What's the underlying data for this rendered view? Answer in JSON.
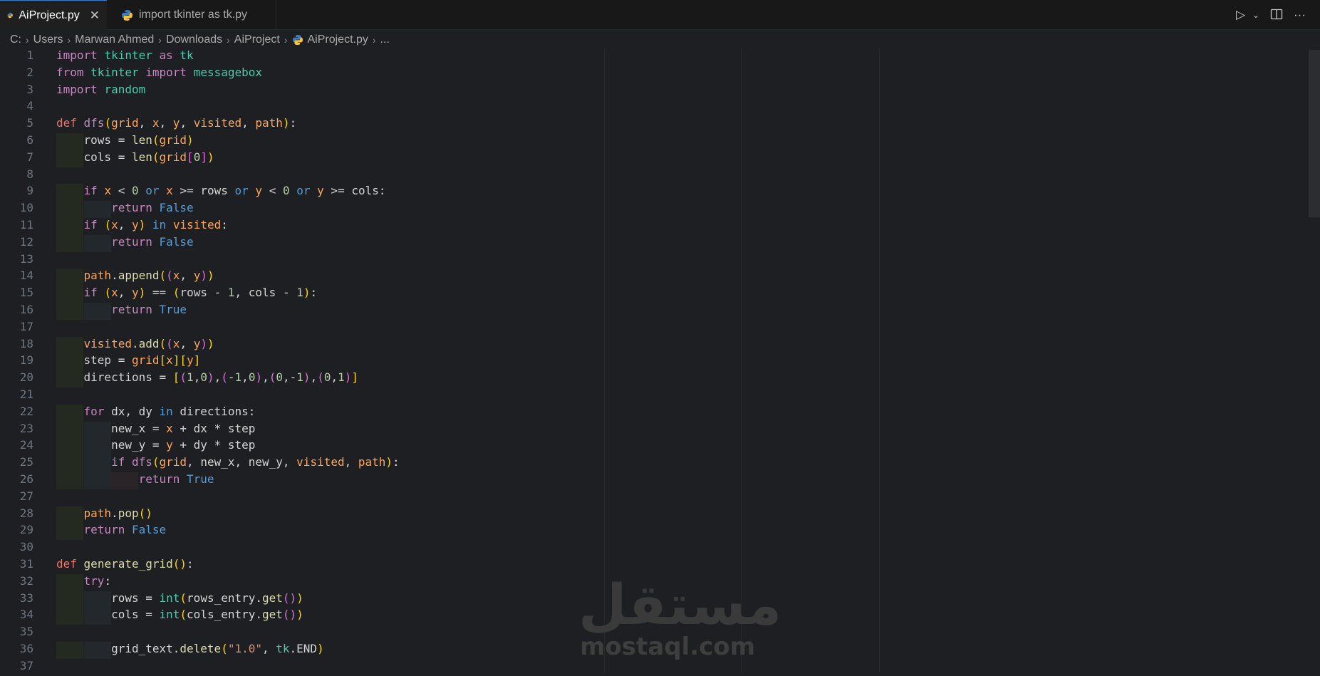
{
  "tabs": [
    {
      "label": "AiProject.py",
      "active": true
    },
    {
      "label": "import tkinter as tk.py",
      "active": false
    }
  ],
  "breadcrumb": [
    "C:",
    "Users",
    "Marwan Ahmed",
    "Downloads",
    "AiProject",
    "AiProject.py",
    "..."
  ],
  "watermark": {
    "arabic": "مستقل",
    "latin": "mostaql.com"
  },
  "lines": [
    {
      "n": "1",
      "html": "<span class=\"kw\">import</span> <span class=\"mod\">tkinter</span> <span class=\"kw\">as</span> <span class=\"mod\">tk</span>"
    },
    {
      "n": "2",
      "html": "<span class=\"kw\">from</span> <span class=\"mod\">tkinter</span> <span class=\"kw\">import</span> <span class=\"mod\">messagebox</span>"
    },
    {
      "n": "3",
      "html": "<span class=\"kw\">import</span> <span class=\"mod\">random</span>"
    },
    {
      "n": "4",
      "html": ""
    },
    {
      "n": "5",
      "html": "<span class=\"def\">def</span> <span class=\"fnc\">dfs</span><span class=\"p1\">(</span><span class=\"prm\">grid</span>, <span class=\"prm\">x</span>, <span class=\"prm\">y</span>, <span class=\"prm\">visited</span>, <span class=\"prm\">path</span><span class=\"p1\">)</span>:"
    },
    {
      "n": "6",
      "html": "    rows = <span class=\"bi\">len</span><span class=\"p1\">(</span><span class=\"prm\">grid</span><span class=\"p1\">)</span>"
    },
    {
      "n": "7",
      "html": "    cols = <span class=\"bi\">len</span><span class=\"p1\">(</span><span class=\"prm\">grid</span><span class=\"p2\">[</span><span class=\"num\">0</span><span class=\"p2\">]</span><span class=\"p1\">)</span>"
    },
    {
      "n": "8",
      "html": ""
    },
    {
      "n": "9",
      "html": "    <span class=\"kw\">if</span> <span class=\"prm\">x</span> &lt; <span class=\"num\">0</span> <span class=\"kw2\">or</span> <span class=\"prm\">x</span> &gt;= rows <span class=\"kw2\">or</span> <span class=\"prm\">y</span> &lt; <span class=\"num\">0</span> <span class=\"kw2\">or</span> <span class=\"prm\">y</span> &gt;= cols:"
    },
    {
      "n": "10",
      "html": "        <span class=\"kw\">return</span> <span class=\"kw2\">False</span>"
    },
    {
      "n": "11",
      "html": "    <span class=\"kw\">if</span> <span class=\"p1\">(</span><span class=\"prm\">x</span>, <span class=\"prm\">y</span><span class=\"p1\">)</span> <span class=\"kw2\">in</span> <span class=\"prm\">visited</span>:"
    },
    {
      "n": "12",
      "html": "        <span class=\"kw\">return</span> <span class=\"kw2\">False</span>"
    },
    {
      "n": "13",
      "html": ""
    },
    {
      "n": "14",
      "html": "    <span class=\"prm\">path</span>.<span class=\"fn\">append</span><span class=\"p1\">(</span><span class=\"p2\">(</span><span class=\"prm\">x</span>, <span class=\"prm\">y</span><span class=\"p2\">)</span><span class=\"p1\">)</span>"
    },
    {
      "n": "15",
      "html": "    <span class=\"kw\">if</span> <span class=\"p1\">(</span><span class=\"prm\">x</span>, <span class=\"prm\">y</span><span class=\"p1\">)</span> == <span class=\"p1\">(</span>rows - <span class=\"num\">1</span>, cols - <span class=\"num\">1</span><span class=\"p1\">)</span>:"
    },
    {
      "n": "16",
      "html": "        <span class=\"kw\">return</span> <span class=\"kw2\">True</span>"
    },
    {
      "n": "17",
      "html": ""
    },
    {
      "n": "18",
      "html": "    <span class=\"prm\">visited</span>.<span class=\"fn\">add</span><span class=\"p1\">(</span><span class=\"p2\">(</span><span class=\"prm\">x</span>, <span class=\"prm\">y</span><span class=\"p2\">)</span><span class=\"p1\">)</span>"
    },
    {
      "n": "19",
      "html": "    step = <span class=\"prm\">grid</span><span class=\"p1\">[</span><span class=\"prm\">x</span><span class=\"p1\">]</span><span class=\"p1\">[</span><span class=\"prm\">y</span><span class=\"p1\">]</span>"
    },
    {
      "n": "20",
      "html": "    directions = <span class=\"p1\">[</span><span class=\"p2\">(</span><span class=\"num\">1</span>,<span class=\"num\">0</span><span class=\"p2\">)</span>,<span class=\"p2\">(</span>-<span class=\"num\">1</span>,<span class=\"num\">0</span><span class=\"p2\">)</span>,<span class=\"p2\">(</span><span class=\"num\">0</span>,-<span class=\"num\">1</span><span class=\"p2\">)</span>,<span class=\"p2\">(</span><span class=\"num\">0</span>,<span class=\"num\">1</span><span class=\"p2\">)</span><span class=\"p1\">]</span>"
    },
    {
      "n": "21",
      "html": ""
    },
    {
      "n": "22",
      "html": "    <span class=\"kw\">for</span> dx, dy <span class=\"kw2\">in</span> directions:"
    },
    {
      "n": "23",
      "html": "        new_x = <span class=\"prm\">x</span> + dx * step"
    },
    {
      "n": "24",
      "html": "        new_y = <span class=\"prm\">y</span> + dy * step"
    },
    {
      "n": "25",
      "html": "        <span class=\"kw\">if</span> <span class=\"fnc\">dfs</span><span class=\"p1\">(</span><span class=\"prm\">grid</span>, new_x, new_y, <span class=\"prm\">visited</span>, <span class=\"prm\">path</span><span class=\"p1\">)</span>:"
    },
    {
      "n": "26",
      "html": "            <span class=\"kw\">return</span> <span class=\"kw2\">True</span>"
    },
    {
      "n": "27",
      "html": ""
    },
    {
      "n": "28",
      "html": "    <span class=\"prm\">path</span>.<span class=\"fn\">pop</span><span class=\"p1\">()</span>"
    },
    {
      "n": "29",
      "html": "    <span class=\"kw\">return</span> <span class=\"kw2\">False</span>"
    },
    {
      "n": "30",
      "html": ""
    },
    {
      "n": "31",
      "html": "<span class=\"def\">def</span> <span class=\"fn\">generate_grid</span><span class=\"p1\">()</span>:"
    },
    {
      "n": "32",
      "html": "    <span class=\"kw\">try</span>:"
    },
    {
      "n": "33",
      "html": "        rows = <span class=\"mod\">int</span><span class=\"p1\">(</span>rows_entry.<span class=\"fn\">get</span><span class=\"p2\">()</span><span class=\"p1\">)</span>"
    },
    {
      "n": "34",
      "html": "        cols = <span class=\"mod\">int</span><span class=\"p1\">(</span>cols_entry.<span class=\"fn\">get</span><span class=\"p2\">()</span><span class=\"p1\">)</span>"
    },
    {
      "n": "35",
      "html": ""
    },
    {
      "n": "36",
      "html": "        grid_text.<span class=\"fn\">delete</span><span class=\"p1\">(</span><span class=\"str\">\"1.0\"</span>, <span class=\"mod\">tk</span>.END<span class=\"p1\">)</span>"
    },
    {
      "n": "37",
      "html": ""
    }
  ]
}
